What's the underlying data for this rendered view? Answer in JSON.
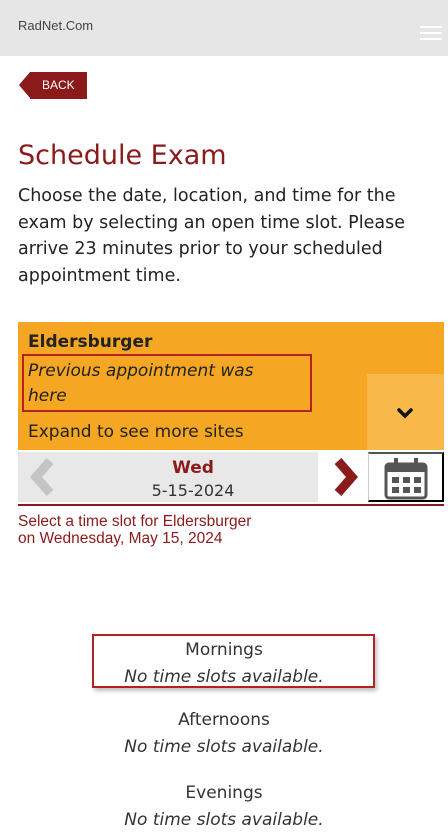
{
  "header": {
    "brand": "RadNet.Com"
  },
  "nav": {
    "back_label": "BACK"
  },
  "page": {
    "title": "Schedule Exam",
    "intro": "Choose the date, location, and time for the exam by selecting an open time slot. Please arrive 23 minutes prior to your scheduled appointment time."
  },
  "site": {
    "name": "Eldersburger",
    "note": "Previous appointment was here",
    "expand": "Expand to see more sites"
  },
  "date_nav": {
    "day": "Wed",
    "date": "5-15-2024"
  },
  "slots": {
    "message_line1": "Select a time slot for Eldersburger",
    "message_line2": "on Wednesday, May 15, 2024",
    "periods": [
      {
        "label": "Mornings",
        "empty": "No time slots available."
      },
      {
        "label": "Afternoons",
        "empty": "No time slots available."
      },
      {
        "label": "Evenings",
        "empty": "No time slots available."
      }
    ]
  },
  "colors": {
    "accent": "#8b1a1a",
    "site_panel": "#f5a623",
    "highlight": "#b22222"
  },
  "icons": [
    "menu-icon",
    "chevron-down-icon",
    "chevron-left-icon",
    "chevron-right-icon",
    "calendar-icon"
  ]
}
